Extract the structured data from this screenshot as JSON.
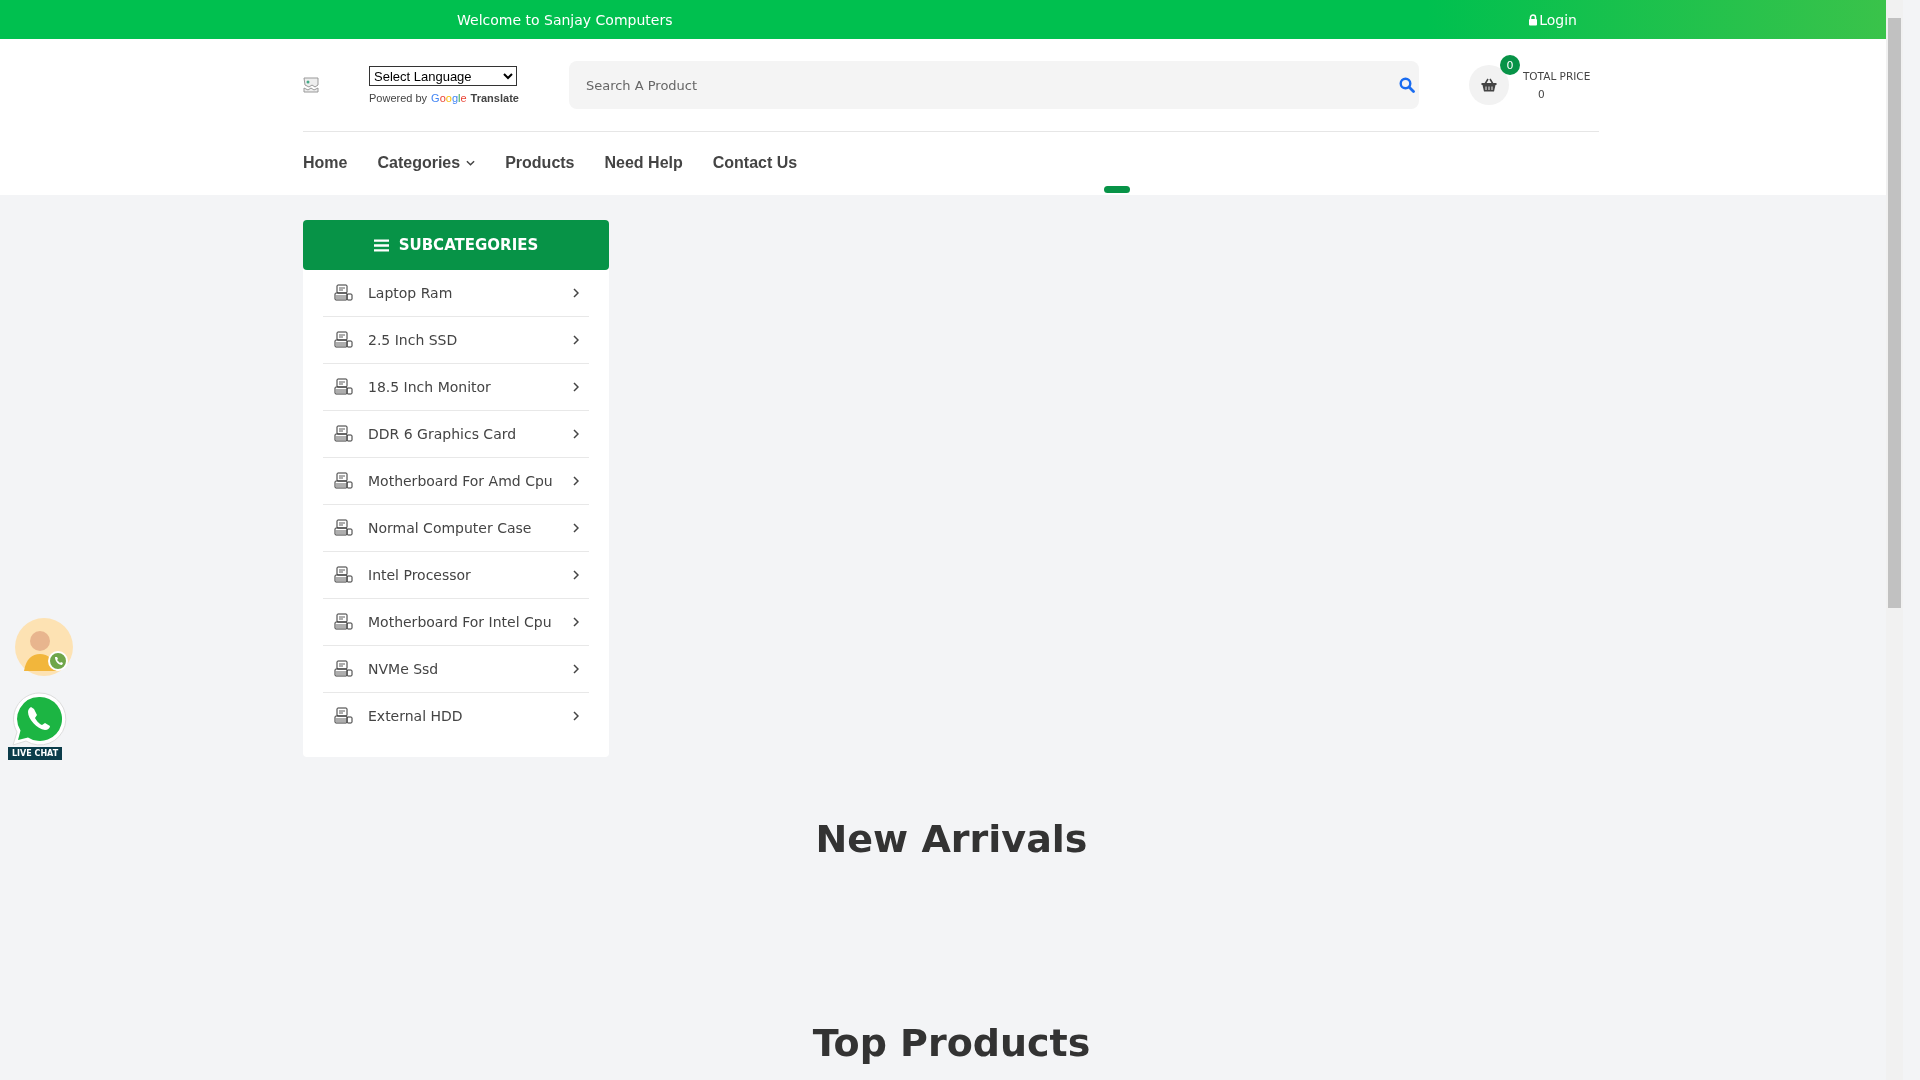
{
  "top_bar": {
    "welcome": "Welcome to Sanjay Computers",
    "login": "Login"
  },
  "header": {
    "language_select": "Select Language",
    "powered_by": "Powered by",
    "google": "Google",
    "translate": "Translate",
    "search": {
      "placeholder": "Search A Product"
    },
    "cart": {
      "count": "0",
      "total_label": "TOTAL PRICE",
      "total_value": "0"
    }
  },
  "nav": [
    {
      "label": "Home",
      "dropdown": false
    },
    {
      "label": "Categories",
      "dropdown": true
    },
    {
      "label": "Products",
      "dropdown": false
    },
    {
      "label": "Need Help",
      "dropdown": false
    },
    {
      "label": "Contact Us",
      "dropdown": false
    }
  ],
  "subcategories": {
    "title": "SUBCATEGORIES",
    "items": [
      "Laptop Ram",
      "2.5 Inch SSD",
      "18.5 Inch Monitor",
      "DDR 6 Graphics Card",
      "Motherboard For Amd Cpu",
      "Normal Computer Case",
      "Intel Processor",
      "Motherboard For Intel Cpu",
      "NVMe Ssd",
      "External HDD"
    ]
  },
  "sections": [
    "New Arrivals",
    "Top Products"
  ],
  "live_chat": {
    "label": "LIVE CHAT"
  }
}
